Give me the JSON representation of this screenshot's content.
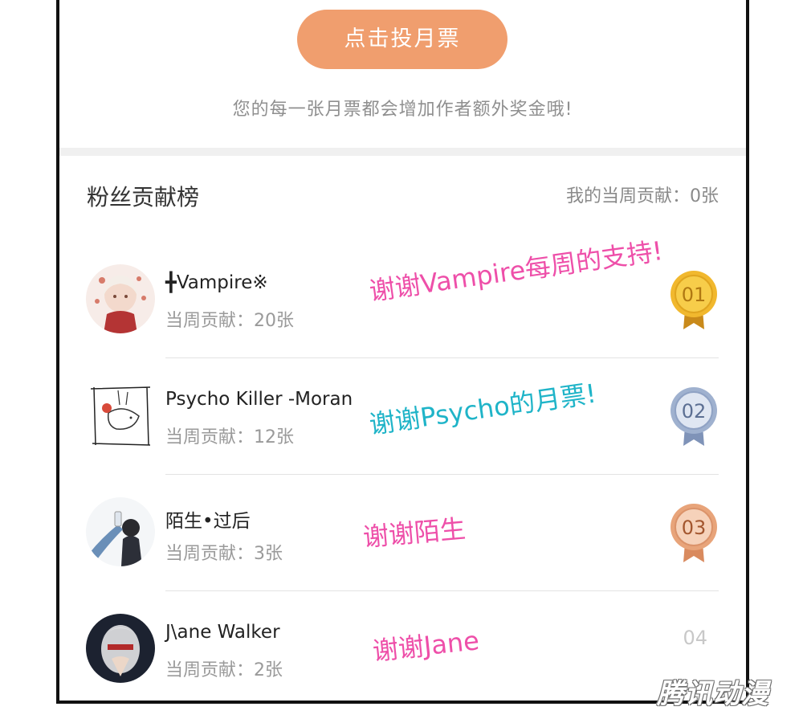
{
  "vote": {
    "button_label": "点击投月票",
    "subtitle": "您的每一张月票都会增加作者额外奖金哦!"
  },
  "ranking": {
    "title": "粉丝贡献榜",
    "my_contribution": "我的当周贡献：0张",
    "rows": [
      {
        "rank": "01",
        "name": "╋Vampire※",
        "contribution": "当周贡献：20张",
        "medal": "gold",
        "medal_color": "#f1b82e",
        "avatar_icon": "anime-girl-avatar",
        "note": "谢谢Vampire每周的支持!",
        "note_color": "#ee4fa9"
      },
      {
        "rank": "02",
        "name": "Psycho Killer -Moran",
        "contribution": "当周贡献：12张",
        "medal": "silver",
        "medal_color": "#9fb1cf",
        "avatar_icon": "sketch-bird-avatar",
        "note": "谢谢Psycho的月票!",
        "note_color": "#1fb4c8"
      },
      {
        "rank": "03",
        "name": "陌生•过后",
        "contribution": "当周贡献：3张",
        "medal": "bronze",
        "medal_color": "#e8a47a",
        "avatar_icon": "person-drinking-avatar",
        "note": "谢谢陌生",
        "note_color": "#ee4fa9"
      },
      {
        "rank": "04",
        "name": "J\\ane  Walker",
        "contribution": "当周贡献：2张",
        "medal": "none",
        "avatar_icon": "masked-face-avatar",
        "note": "谢谢Jane",
        "note_color": "#ee4fa9"
      }
    ]
  },
  "watermark": "腾讯动漫",
  "colors": {
    "accent": "#f09e6e",
    "frame": "#111111",
    "divider": "#e3e3e3"
  }
}
